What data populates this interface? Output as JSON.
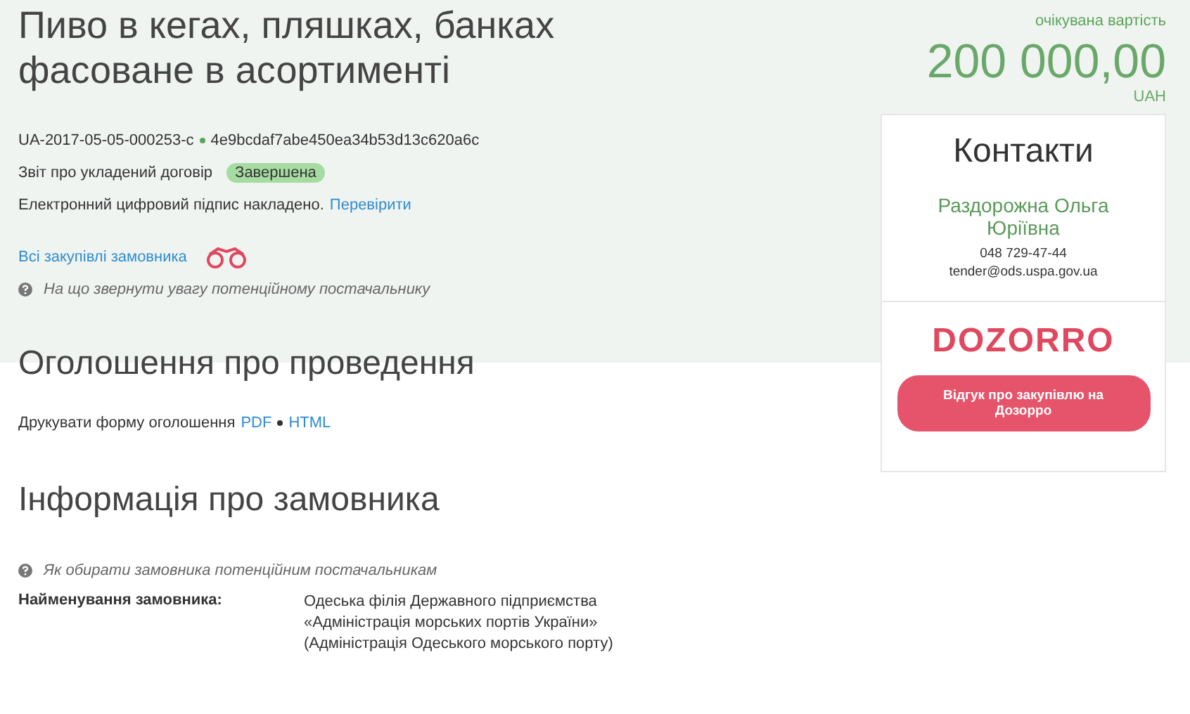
{
  "tender": {
    "title": "Пиво в кегах, пляшках, банках фасоване в асортименті",
    "id": "UA-2017-05-05-000253-c",
    "hash": "4e9bcdaf7abe450ea34b53d13c620a6c",
    "report_label": "Звіт про укладений договір",
    "status": "Завершена",
    "signature_text": "Електронний цифровий підпис накладено.",
    "signature_link": "Перевірити",
    "all_purchases_link": "Всі закупівлі замовника",
    "hint": "На що звернути увагу потенційному постачальнику"
  },
  "value": {
    "label": "очікувана вартість",
    "amount": "200 000,00",
    "currency": "UAH"
  },
  "contacts": {
    "title": "Контакти",
    "name": "Раздорожна Ольга Юріївна",
    "phone": "048 729-47-44",
    "email": "tender@ods.uspa.gov.ua",
    "logo": "DOZORRO",
    "button": "Відгук про закупівлю на Дозорро"
  },
  "announcement": {
    "heading": "Оголошення про проведення",
    "print_label": "Друкувати форму оголошення",
    "links": [
      "PDF",
      "HTML"
    ]
  },
  "customer": {
    "heading": "Інформація про замовника",
    "hint": "Як обирати замовника потенційним постачальникам",
    "fields": [
      {
        "label": "Найменування замовника:",
        "lines": [
          "Одеська філія Державного підприємства",
          "«Адміністрація морських портів України»",
          "(Адміністрація Одеського морського порту)"
        ]
      }
    ]
  }
}
